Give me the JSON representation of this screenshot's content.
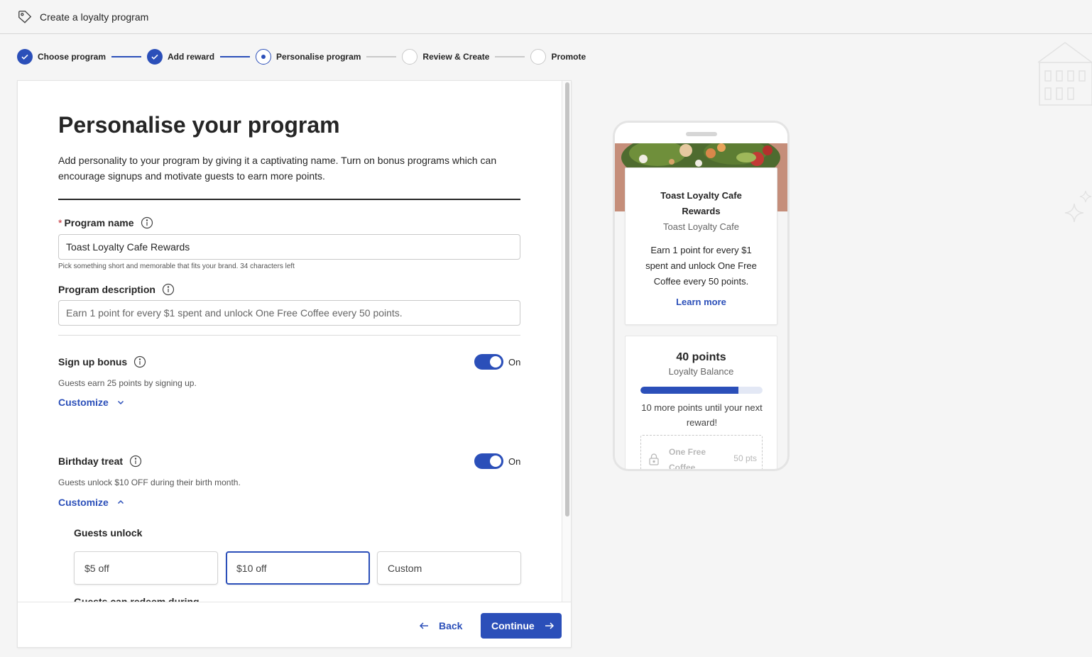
{
  "header": {
    "title": "Create a loyalty program",
    "icon": "tag-icon"
  },
  "stepper": [
    {
      "label": "Choose program",
      "state": "done"
    },
    {
      "label": "Add reward",
      "state": "done"
    },
    {
      "label": "Personalise program",
      "state": "current"
    },
    {
      "label": "Review & Create",
      "state": "todo"
    },
    {
      "label": "Promote",
      "state": "todo"
    }
  ],
  "form": {
    "title": "Personalise your program",
    "intro": "Add personality to your program by giving it a captivating name. Turn on bonus programs which can encourage signups and motivate guests to earn more points.",
    "program_name": {
      "required_mark": "*",
      "label": "Program name",
      "value": "Toast Loyalty Cafe Rewards",
      "hint": "Pick something short and memorable that fits your brand. 34 characters left"
    },
    "program_description": {
      "label": "Program description",
      "placeholder": "Earn 1 point for every $1 spent and unlock One Free Coffee every 50 points."
    },
    "signup_bonus": {
      "label": "Sign up bonus",
      "toggle_state": "On",
      "description": "Guests earn 25 points by signing up.",
      "customize": "Customize"
    },
    "birthday_treat": {
      "label": "Birthday treat",
      "toggle_state": "On",
      "description": "Guests unlock $10 OFF during their birth month.",
      "customize": "Customize",
      "guests_unlock_label": "Guests unlock",
      "options": [
        "$5 off",
        "$10 off",
        "Custom"
      ],
      "selected_option": "$10 off",
      "next_label": "Guests can redeem during"
    }
  },
  "footer": {
    "back_label": "Back",
    "continue_label": "Continue"
  },
  "preview": {
    "program_name": "Toast Loyalty Cafe Rewards",
    "cafe_name": "Toast Loyalty Cafe",
    "description": "Earn 1 point for every $1 spent and unlock One Free Coffee every 50 points.",
    "learn_more": "Learn more",
    "balance_points": "40 points",
    "balance_label": "Loyalty Balance",
    "progress_fraction": 0.8,
    "progress_text": "10 more points until your next reward!",
    "reward_name": "One Free Coffee",
    "reward_points": "50 pts"
  },
  "colors": {
    "accent": "#2b4fb9",
    "required": "#c0262d"
  }
}
